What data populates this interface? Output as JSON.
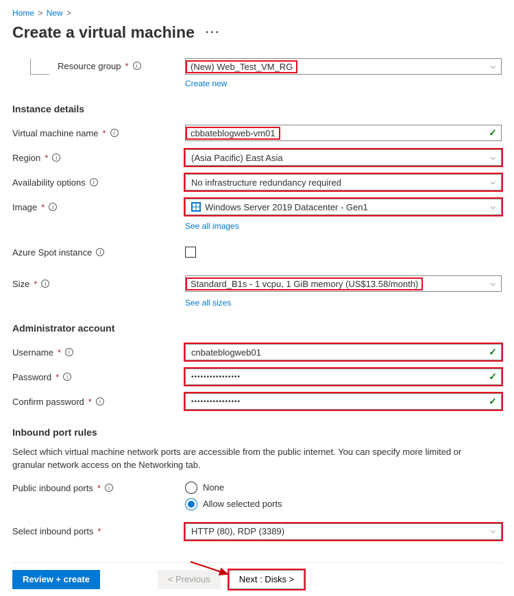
{
  "breadcrumb": {
    "home": "Home",
    "new": "New"
  },
  "title": "Create a virtual machine",
  "resourceGroup": {
    "label": "Resource group",
    "value": "(New) Web_Test_VM_RG",
    "createNew": "Create new"
  },
  "instanceDetails": {
    "heading": "Instance details",
    "vmName": {
      "label": "Virtual machine name",
      "value": "cbbateblogweb-vm01"
    },
    "region": {
      "label": "Region",
      "value": "(Asia Pacific) East Asia"
    },
    "availability": {
      "label": "Availability options",
      "value": "No infrastructure redundancy required"
    },
    "image": {
      "label": "Image",
      "value": "Windows Server 2019 Datacenter - Gen1",
      "seeAll": "See all images"
    },
    "spot": {
      "label": "Azure Spot instance"
    },
    "size": {
      "label": "Size",
      "value": "Standard_B1s - 1 vcpu, 1 GiB memory (US$13.58/month)",
      "seeAll": "See all sizes"
    }
  },
  "admin": {
    "heading": "Administrator account",
    "username": {
      "label": "Username",
      "value": "cnbateblogweb01"
    },
    "password": {
      "label": "Password",
      "value": "••••••••••••••••"
    },
    "confirm": {
      "label": "Confirm password",
      "value": "••••••••••••••••"
    }
  },
  "inbound": {
    "heading": "Inbound port rules",
    "desc": "Select which virtual machine network ports are accessible from the public internet. You can specify more limited or granular network access on the Networking tab.",
    "publicPorts": {
      "label": "Public inbound ports",
      "none": "None",
      "allow": "Allow selected ports"
    },
    "selectPorts": {
      "label": "Select inbound ports",
      "value": "HTTP (80), RDP (3389)"
    }
  },
  "footer": {
    "review": "Review + create",
    "prev": "< Previous",
    "next": "Next : Disks >"
  }
}
